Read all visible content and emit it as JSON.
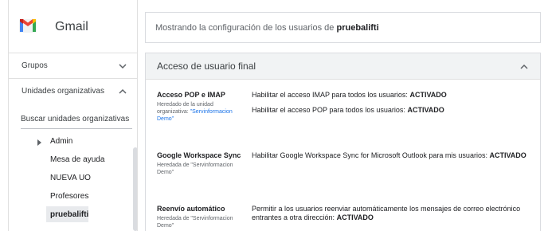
{
  "sidebar": {
    "brand": "Gmail",
    "sections": [
      {
        "label": "Grupos"
      },
      {
        "label": "Unidades organizativas"
      }
    ],
    "search_label": "Buscar unidades organizativas",
    "ous": [
      "Admin",
      "Mesa de ayuda",
      "NUEVA UO",
      "Profesores",
      "pruebalifti"
    ]
  },
  "banner": {
    "prefix": "Mostrando la configuración de los usuarios de",
    "ou": "pruebalifti"
  },
  "card": {
    "title": "Acceso de usuario final",
    "rows": [
      {
        "name": "Acceso POP e IMAP",
        "inherited_prefix": "Heredado de la unidad organizativa:",
        "inherited_link": "\"Servinformacion Demo\"",
        "values": [
          {
            "text": "Habilitar el acceso IMAP para todos los usuarios:",
            "state": "ACTIVADO"
          },
          {
            "text": "Habilitar el acceso POP para todos los usuarios:",
            "state": "ACTIVADO"
          }
        ]
      },
      {
        "name": "Google Workspace Sync",
        "inherited": "Heredada de \"Servinformacion Demo\"",
        "values": [
          {
            "text": "Habilitar Google Workspace Sync for Microsoft Outlook para mis usuarios:",
            "state": "ACTIVADO"
          }
        ]
      },
      {
        "name": "Reenvío automático",
        "inherited": "Heredada de \"Servinformacion Demo\"",
        "values": [
          {
            "text": "Permitir a los usuarios reenviar automáticamente los mensajes de correo electrónico entrantes a otra dirección:",
            "state": "ACTIVADO"
          }
        ]
      }
    ]
  },
  "colors": {
    "gmail_red": "#ea4335",
    "gmail_blue": "#4285f4",
    "gmail_green": "#34a853",
    "gmail_yellow": "#fbbc04",
    "link": "#1a73e8",
    "card_header": "#f1f3f4"
  },
  "icons": [
    "gmail-logo-icon",
    "chevron-down-icon",
    "chevron-up-icon",
    "expand-arrow-icon"
  ]
}
